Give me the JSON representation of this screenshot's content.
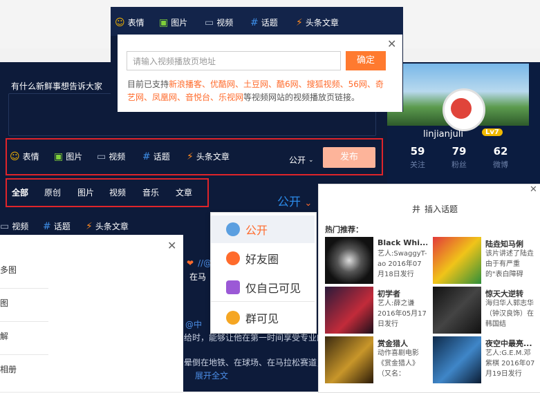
{
  "compose": {
    "prompt": "有什么新鲜事想告诉大家",
    "toolbar": {
      "emoji": "表情",
      "image": "图片",
      "video": "视频",
      "topic": "话题",
      "article": "头条文章",
      "visibility": "公开",
      "publish": "发布"
    }
  },
  "profile": {
    "username": "linjianjuli",
    "level": "Lv7",
    "stats": [
      {
        "value": "59",
        "label": "关注"
      },
      {
        "value": "79",
        "label": "粉丝"
      },
      {
        "value": "62",
        "label": "微博"
      }
    ]
  },
  "filter_tabs": [
    "全部",
    "原创",
    "图片",
    "视频",
    "音乐",
    "文章"
  ],
  "visibility_big": "公开",
  "lower_toolbar": {
    "video": "视频",
    "topic": "话题",
    "article": "头条文章"
  },
  "video_popup": {
    "tabs": {
      "emoji": "表情",
      "image": "图片",
      "video": "视频",
      "topic": "话题",
      "article": "头条文章"
    },
    "placeholder": "请输入视频播放页地址",
    "confirm": "确定",
    "desc_prefix": "目前已支持",
    "sites": "新浪播客、优酷网、土豆网、酷6网、搜狐视频、56网、奇艺网、凤凰网、音悦台、乐视网",
    "desc_suffix": "等视频网站的视频播放页链接。"
  },
  "privacy_menu": {
    "items": [
      "公开",
      "好友圈",
      "仅自己可见",
      "群可见"
    ],
    "selected": "公开"
  },
  "album_panel": {
    "items": [
      "多图",
      "图",
      "解",
      "相册"
    ]
  },
  "background_text": {
    "line1": "//@",
    "line2": "在马",
    "line3": "@中",
    "line4": "给时，能够让他在第一时间享受专业的",
    "line5": "晕倒在地铁、在球场、在马拉松赛道，",
    "line6": "展开全文"
  },
  "topic_panel": {
    "title": "插入话题",
    "hot_label": "热门推荐：",
    "cards": [
      {
        "title": "Black Whi...",
        "desc": "艺人:SwaggyT-ao 2016年07月18日发行"
      },
      {
        "title": "陆垚知马俐",
        "desc": "该片讲述了陆垚由于有严重的\"表白障碍"
      },
      {
        "title": "初学者",
        "desc": "艺人:薛之谦 2016年05月17日发行"
      },
      {
        "title": "惊天大逆转",
        "desc": "海归华人郭志华（钟汉良饰）在韩国结"
      },
      {
        "title": "赏金猎人",
        "desc": "动作喜剧电影《赏金猎人》（又名："
      },
      {
        "title": "夜空中最亮...",
        "desc": "艺人:G.E.M.邓紫棋 2016年07月19日发行"
      }
    ]
  }
}
